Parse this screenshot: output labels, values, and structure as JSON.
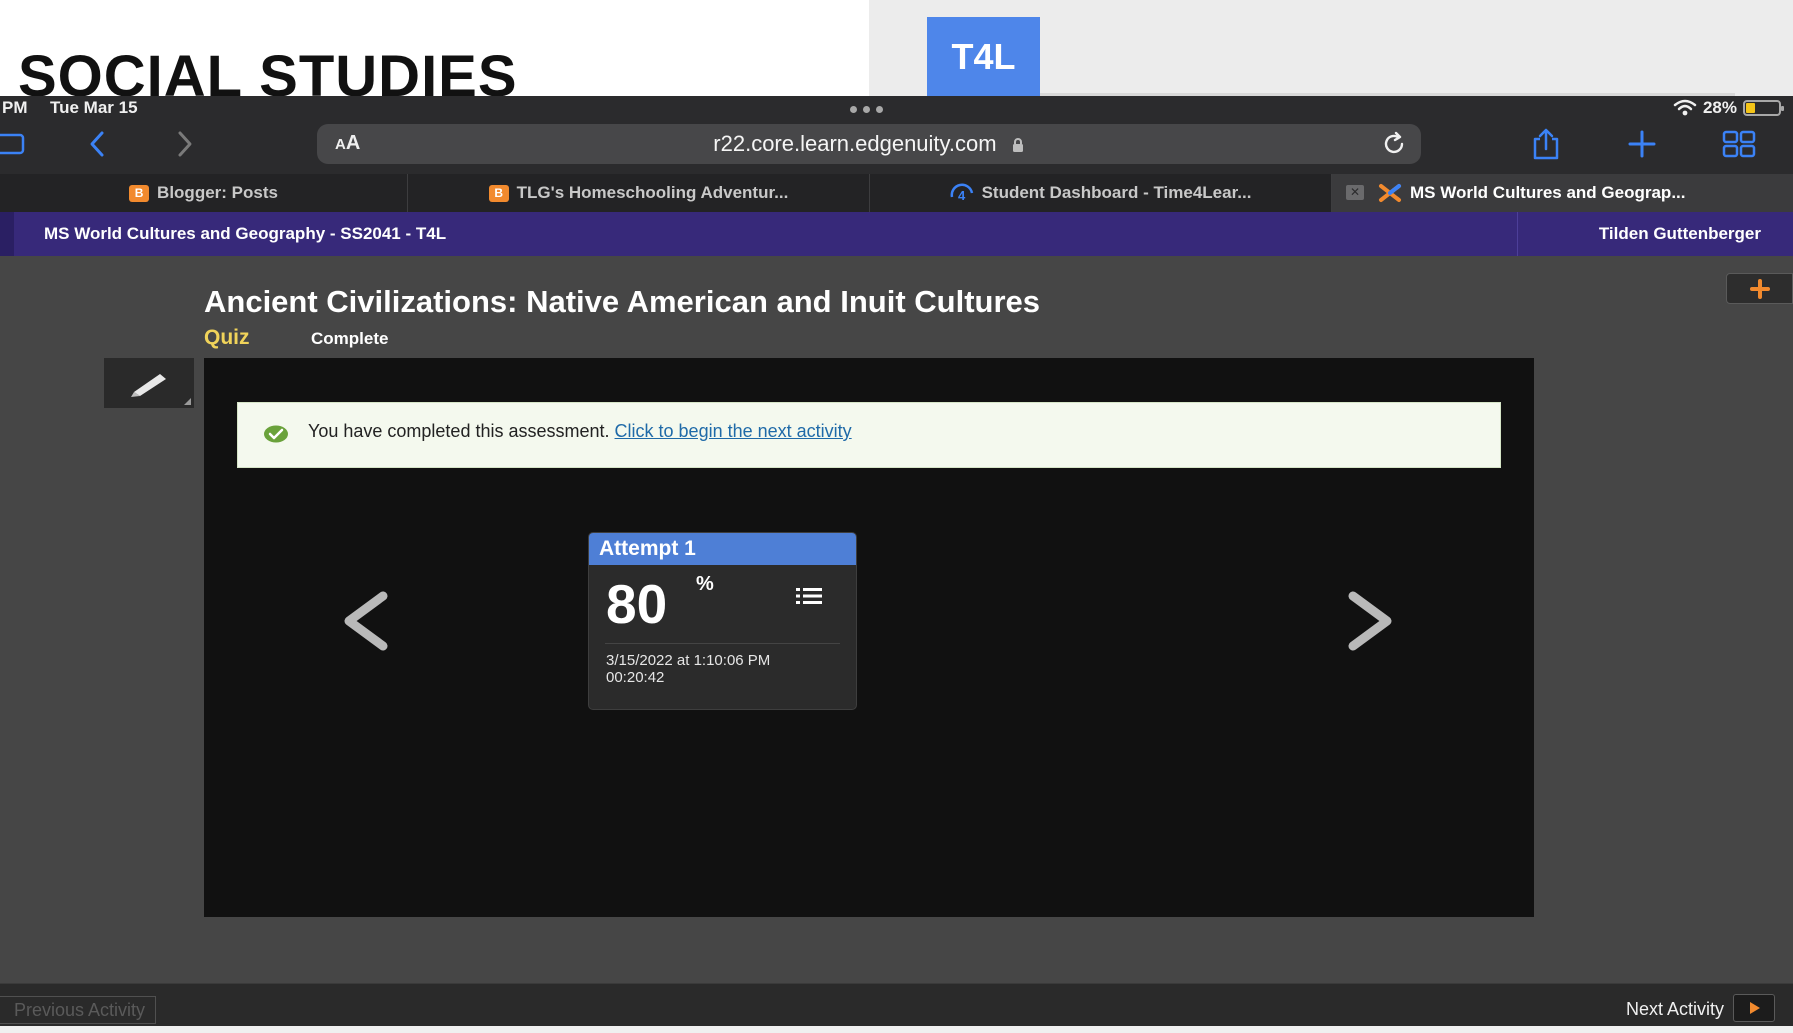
{
  "overlay": {
    "heading": "SOCIAL STUDIES",
    "tile_label": "T4L",
    "tile_color": "#4e86ea"
  },
  "status_bar": {
    "time": "PM",
    "date": "Tue Mar 15",
    "battery": "28%",
    "battery_level": 0.28,
    "wifi_icon": "wifi-icon"
  },
  "browser": {
    "text_size_label_small": "A",
    "text_size_label_large": "A",
    "url": "r22.core.learn.edgenuity.com",
    "icons": [
      "sidebar-icon",
      "back-icon",
      "forward-icon",
      "lock-icon",
      "reload-icon",
      "share-icon",
      "new-tab-icon",
      "tab-overview-icon"
    ],
    "accent_color": "#3b82f6"
  },
  "tabs": [
    {
      "label": "Blogger: Posts",
      "favicon": "blogger-icon"
    },
    {
      "label": "TLG's Homeschooling Adventur...",
      "favicon": "blogger-icon"
    },
    {
      "label": "Student Dashboard - Time4Lear...",
      "favicon": "time4learning-icon"
    },
    {
      "label": "MS World Cultures and Geograp...",
      "favicon": "edgenuity-icon",
      "active": true
    }
  ],
  "header": {
    "course_title": "MS World Cultures and Geography - SS2041 - T4L",
    "user_name": "Tilden Guttenberger",
    "color": "#37297a"
  },
  "activity": {
    "title": "Ancient Civilizations: Native American and Inuit Cultures",
    "type": "Quiz",
    "status": "Complete"
  },
  "banner": {
    "message": "You have completed this assessment.",
    "link": "Click to begin the next activity"
  },
  "attempt": {
    "label": "Attempt 1",
    "score": "80",
    "score_unit": "%",
    "date": "3/15/2022 at 1:10:06 PM",
    "duration": "00:20:42"
  },
  "footer": {
    "previous": "Previous Activity",
    "next": "Next Activity",
    "next_color": "#f28a2e"
  }
}
